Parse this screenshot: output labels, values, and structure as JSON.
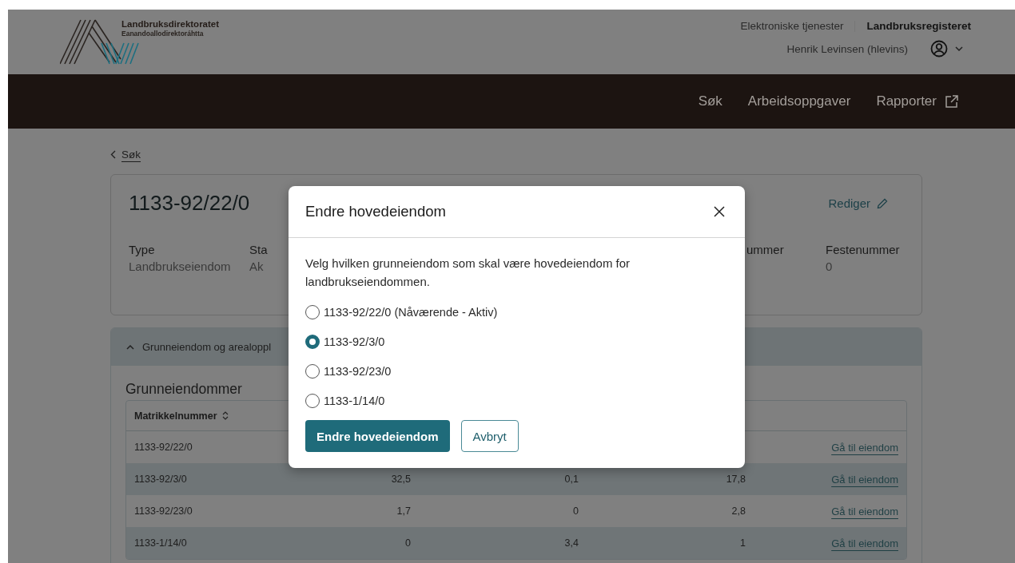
{
  "header": {
    "logo": {
      "name": "Landbruksdirektoratet",
      "subtitle": "Eanandoallodirektoráhtta"
    },
    "links": [
      {
        "label": "Elektroniske tjenester",
        "selected": false
      },
      {
        "label": "Landbruksregisteret",
        "selected": true
      }
    ],
    "user": "Henrik Levinsen (hlevins)"
  },
  "nav": [
    {
      "label": "Søk",
      "external": false
    },
    {
      "label": "Arbeidsoppgaver",
      "external": false
    },
    {
      "label": "Rapporter",
      "external": true
    }
  ],
  "back_link": "Søk",
  "property": {
    "title": "1133-92/22/0",
    "edit": "Rediger",
    "fields": [
      {
        "label": "Type",
        "value": "Landbrukseiendom"
      },
      {
        "label": "Sta",
        "value": "Ak"
      },
      {
        "label": "ummer"
      },
      {
        "label": "Festenummer",
        "value": "0"
      }
    ]
  },
  "accordion": {
    "title": "Grunneiendom og arealoppl",
    "expanded": true
  },
  "table": {
    "title": "Grunneiendommer",
    "columns": [
      "Matrikkelnummer"
    ],
    "rows": [
      {
        "matrikkelnummer": "1133-92/22/0",
        "link": "Gå til eiendom"
      },
      {
        "matrikkelnummer": "1133-92/3/0",
        "column_2": "32,5",
        "column_3": "0,1",
        "column_4": "17,8",
        "link": "Gå til eiendom"
      },
      {
        "matrikkelnummer": "1133-92/23/0",
        "column_2": "1,7",
        "column_3": "0",
        "column_4": "2,8",
        "link": "Gå til eiendom"
      },
      {
        "matrikkelnummer": "1133-1/14/0",
        "column_2": "0",
        "column_3": "3,4",
        "column_4": "1",
        "link": "Gå til eiendom"
      }
    ]
  },
  "dialog": {
    "title": "Endre hovedeiendom",
    "text": "Velg hvilken grunneiendom som skal være hovedeiendom for landbrukseiendommen.",
    "options": [
      {
        "label": "1133-92/22/0 (Nåværende - Aktiv)",
        "selected": false
      },
      {
        "label": "1133-92/3/0",
        "selected": true
      },
      {
        "label": "1133-92/23/0",
        "selected": false
      },
      {
        "label": "1133-1/14/0",
        "selected": false
      }
    ],
    "buttons": [
      {
        "label": "Endre hovedeiendom",
        "kind": "primary"
      },
      {
        "label": "Avbryt",
        "kind": "secondary"
      }
    ]
  }
}
